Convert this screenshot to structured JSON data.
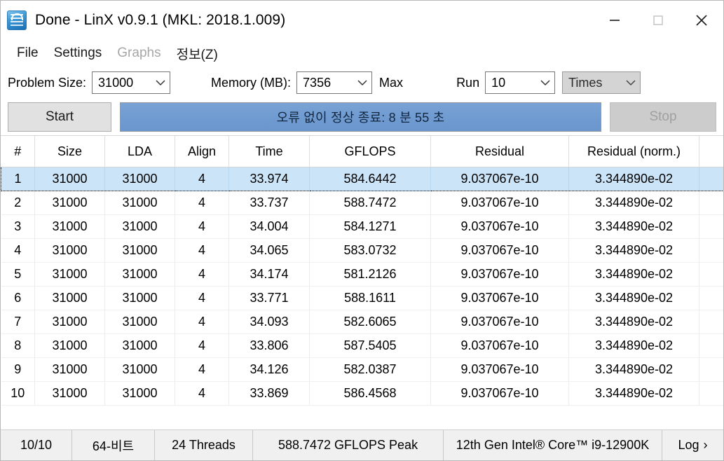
{
  "window": {
    "title": "Done - LinX v0.9.1 (MKL: 2018.1.009)",
    "icon": "intel-linx-icon",
    "minimize_label": "minimize-icon",
    "maximize_label": "maximize-icon",
    "close_label": "close-icon"
  },
  "menu": [
    {
      "label": "File",
      "disabled": false
    },
    {
      "label": "Settings",
      "disabled": false
    },
    {
      "label": "Graphs",
      "disabled": true
    },
    {
      "label": "정보(Z)",
      "disabled": false
    }
  ],
  "toolbar": {
    "problem_size_label": "Problem Size:",
    "problem_size_value": "31000",
    "memory_label": "Memory (MB):",
    "memory_value": "7356",
    "max_label": "Max",
    "run_label": "Run",
    "run_value": "10",
    "times_value": "Times",
    "start_label": "Start",
    "stop_label": "Stop",
    "progress_text": "오류 없이 정상 종료: 8 분 55 초",
    "progress_percent": 100,
    "progress_color": "#6f9bd1"
  },
  "table": {
    "columns": [
      "#",
      "Size",
      "LDA",
      "Align",
      "Time",
      "GFLOPS",
      "Residual",
      "Residual (norm.)"
    ],
    "selected_row_index": 0,
    "selected_row_color": "#cce4f7",
    "rows": [
      [
        "1",
        "31000",
        "31000",
        "4",
        "33.974",
        "584.6442",
        "9.037067e-10",
        "3.344890e-02"
      ],
      [
        "2",
        "31000",
        "31000",
        "4",
        "33.737",
        "588.7472",
        "9.037067e-10",
        "3.344890e-02"
      ],
      [
        "3",
        "31000",
        "31000",
        "4",
        "34.004",
        "584.1271",
        "9.037067e-10",
        "3.344890e-02"
      ],
      [
        "4",
        "31000",
        "31000",
        "4",
        "34.065",
        "583.0732",
        "9.037067e-10",
        "3.344890e-02"
      ],
      [
        "5",
        "31000",
        "31000",
        "4",
        "34.174",
        "581.2126",
        "9.037067e-10",
        "3.344890e-02"
      ],
      [
        "6",
        "31000",
        "31000",
        "4",
        "33.771",
        "588.1611",
        "9.037067e-10",
        "3.344890e-02"
      ],
      [
        "7",
        "31000",
        "31000",
        "4",
        "34.093",
        "582.6065",
        "9.037067e-10",
        "3.344890e-02"
      ],
      [
        "8",
        "31000",
        "31000",
        "4",
        "33.806",
        "587.5405",
        "9.037067e-10",
        "3.344890e-02"
      ],
      [
        "9",
        "31000",
        "31000",
        "4",
        "34.126",
        "582.0387",
        "9.037067e-10",
        "3.344890e-02"
      ],
      [
        "10",
        "31000",
        "31000",
        "4",
        "33.869",
        "586.4568",
        "9.037067e-10",
        "3.344890e-02"
      ]
    ]
  },
  "statusbar": {
    "progress_count": "10/10",
    "architecture": "64-비트",
    "threads": "24 Threads",
    "peak": "588.7472 GFLOPS Peak",
    "cpu": "12th Gen Intel® Core™ i9-12900K",
    "log_label": "Log",
    "log_chevron": "›"
  }
}
